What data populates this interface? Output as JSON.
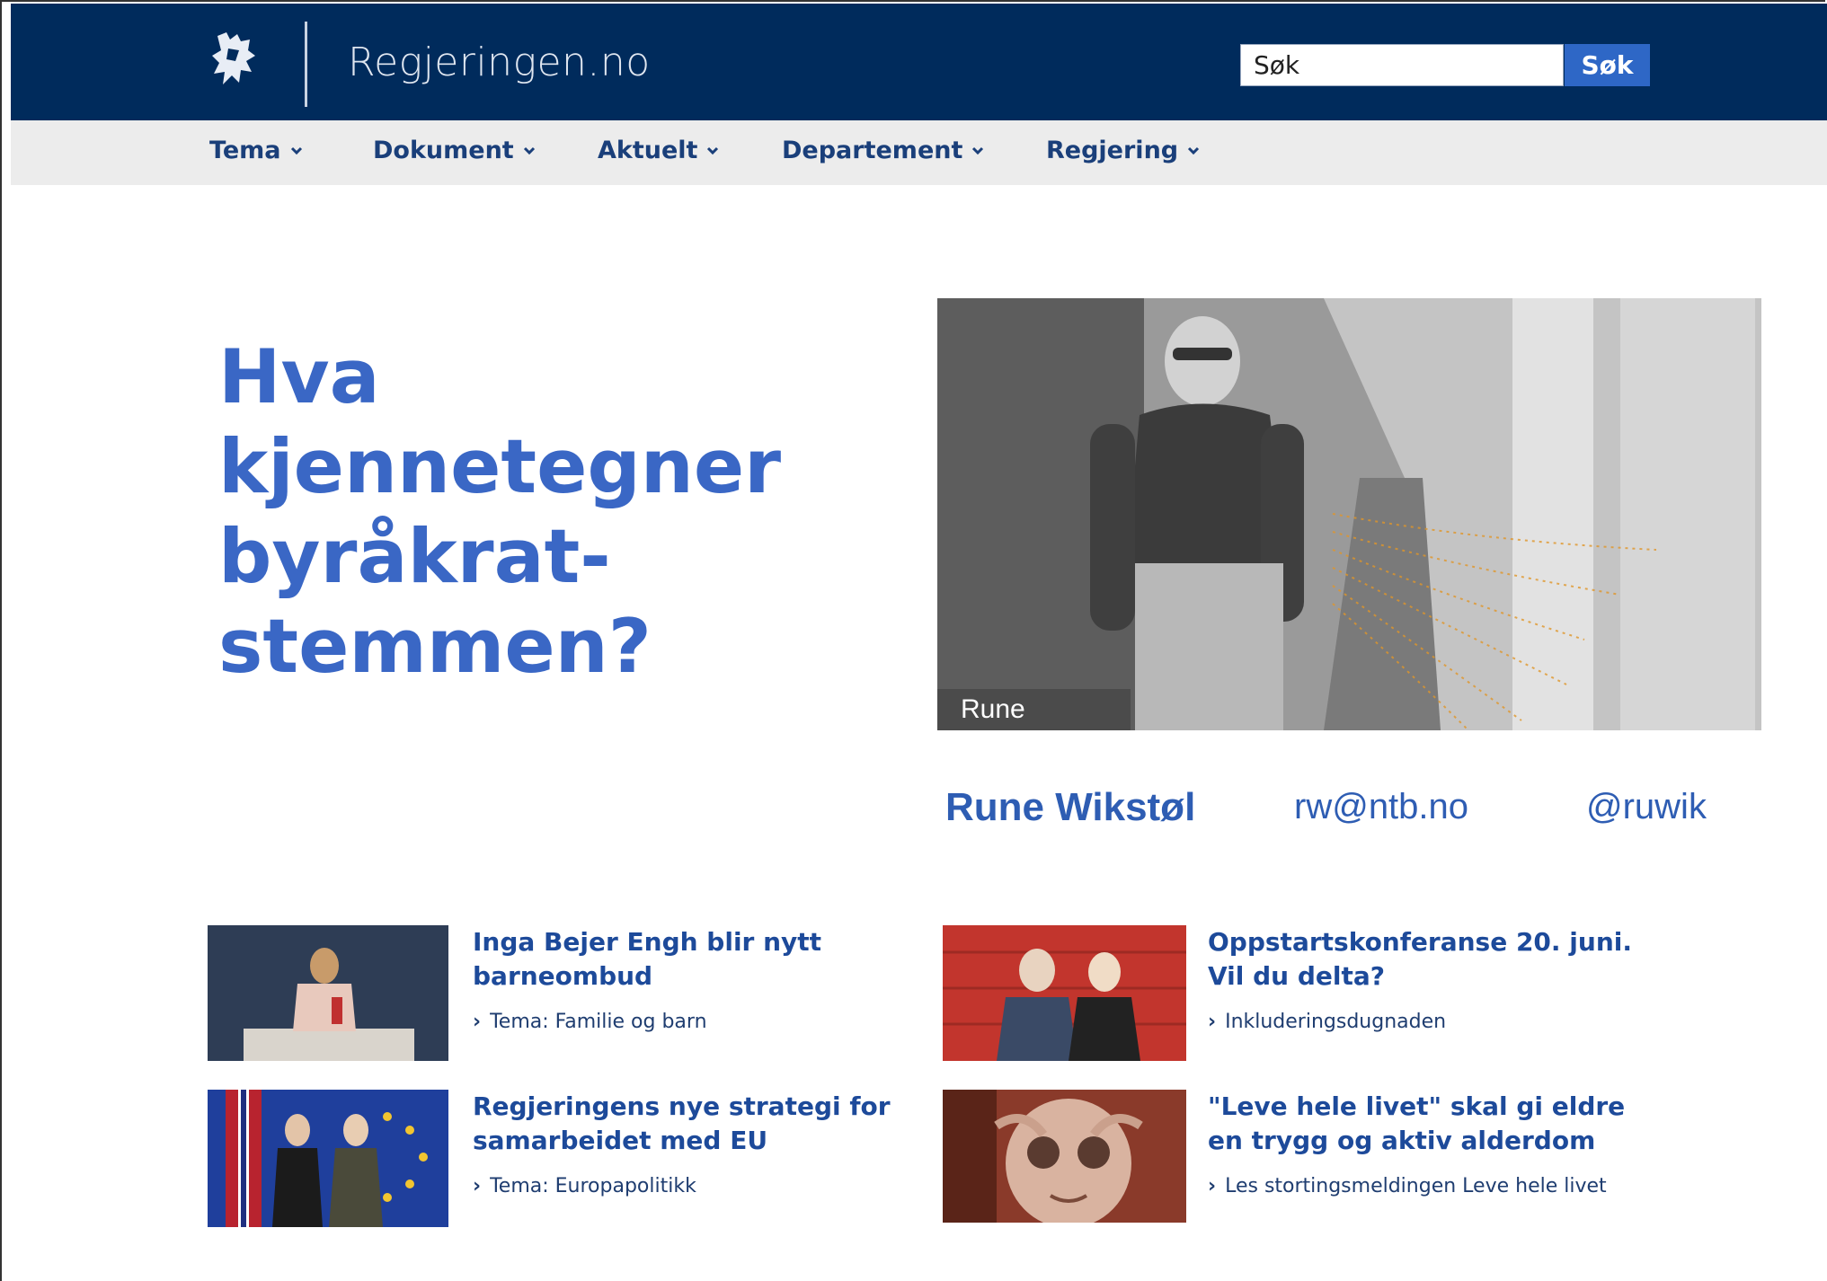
{
  "header": {
    "site_name": "Regjeringen.no",
    "search_placeholder": "Søk",
    "search_button": "Søk",
    "colors": {
      "topbar": "#002b5c",
      "navbar": "#ececec",
      "accent": "#2e67c6"
    }
  },
  "nav": {
    "items": [
      {
        "label": "Tema"
      },
      {
        "label": "Dokument"
      },
      {
        "label": "Aktuelt"
      },
      {
        "label": "Departement"
      },
      {
        "label": "Regjering"
      }
    ]
  },
  "hero": {
    "headline_lines": [
      "Hva",
      "kjennetegner",
      "byråkrat-",
      "stemmen?"
    ],
    "photo_caption": "Rune",
    "photo_icon": "person-portrait-photo"
  },
  "author": {
    "name": "Rune Wikstøl",
    "email": "rw@ntb.no",
    "handle": "@ruwik"
  },
  "news": [
    {
      "title": "Inga Bejer Engh blir nytt barneombud",
      "link": "Tema: Familie og barn"
    },
    {
      "title": "Oppstartskonferanse 20. juni. Vil du delta?",
      "link": "Inkluderingsdugnaden"
    },
    {
      "title": "Regjeringens nye strategi for samarbeidet med EU",
      "link": "Tema: Europapolitikk"
    },
    {
      "title": "\"Leve hele livet\" skal gi eldre en trygg og aktiv alderdom",
      "link": "Les stortingsmeldingen Leve hele livet"
    }
  ]
}
